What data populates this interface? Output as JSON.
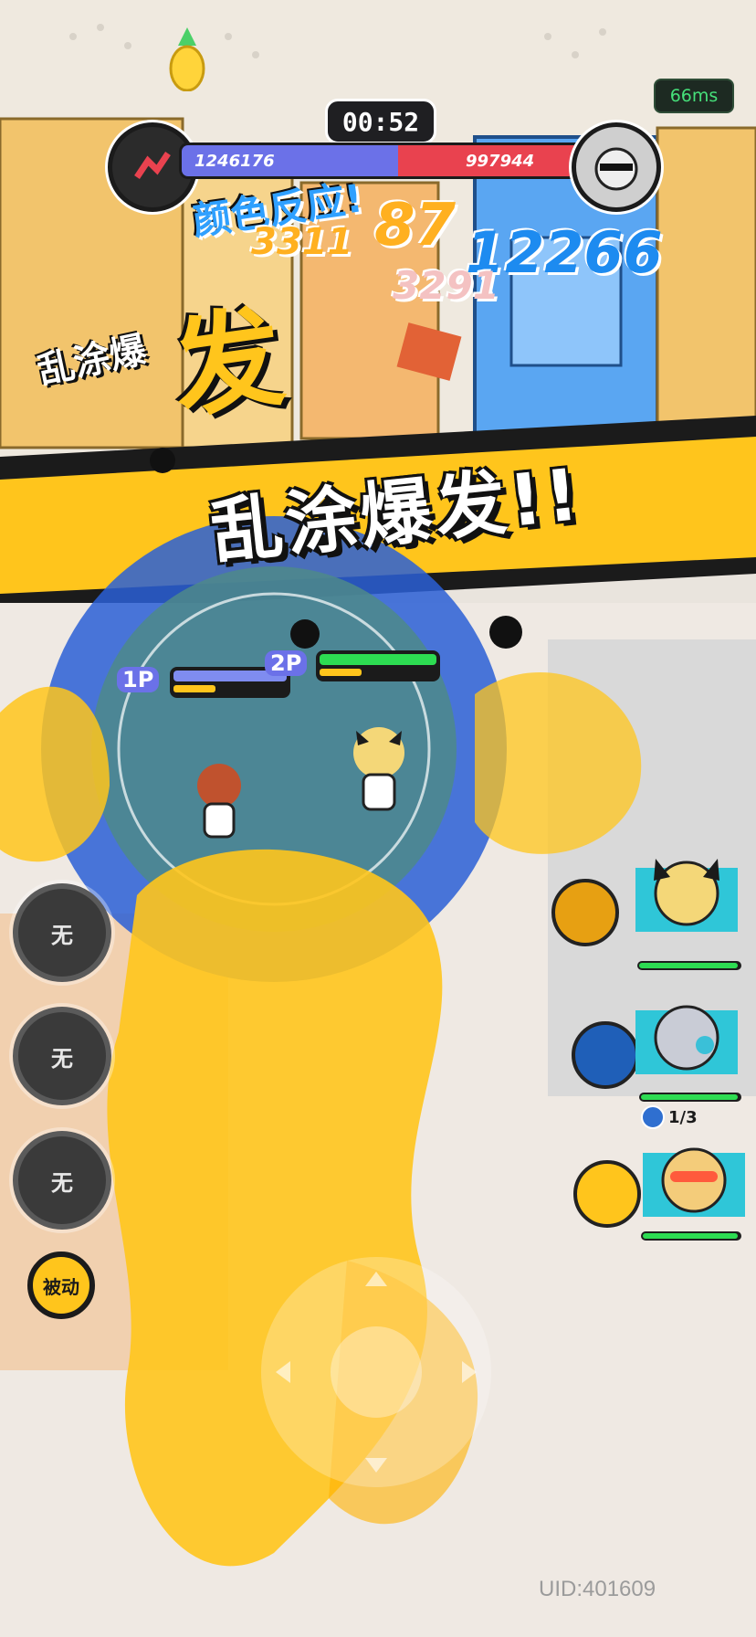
{
  "hud": {
    "timer": "00:52",
    "ping": "66ms",
    "score_left": "1246176",
    "score_right": "997944",
    "uid": "UID:401609"
  },
  "effects": {
    "main_banner": "乱涂爆发!!",
    "burst_small": "乱涂爆",
    "burst_big": "发",
    "chain_text": "颜色反应!",
    "damage_numbers": [
      "3311",
      "12266",
      "3291",
      "87"
    ]
  },
  "players": {
    "p1_tag": "1P",
    "p2_tag": "2P"
  },
  "skills": {
    "slot1": "无",
    "slot2": "无",
    "slot3": "无",
    "passive": "被动"
  },
  "team": {
    "char2_counter": "1/3"
  },
  "colors": {
    "team_blue": "#6b71e8",
    "team_red": "#e9424f",
    "paint_yellow": "#ffc51c",
    "hp_green": "#2ddc52"
  }
}
